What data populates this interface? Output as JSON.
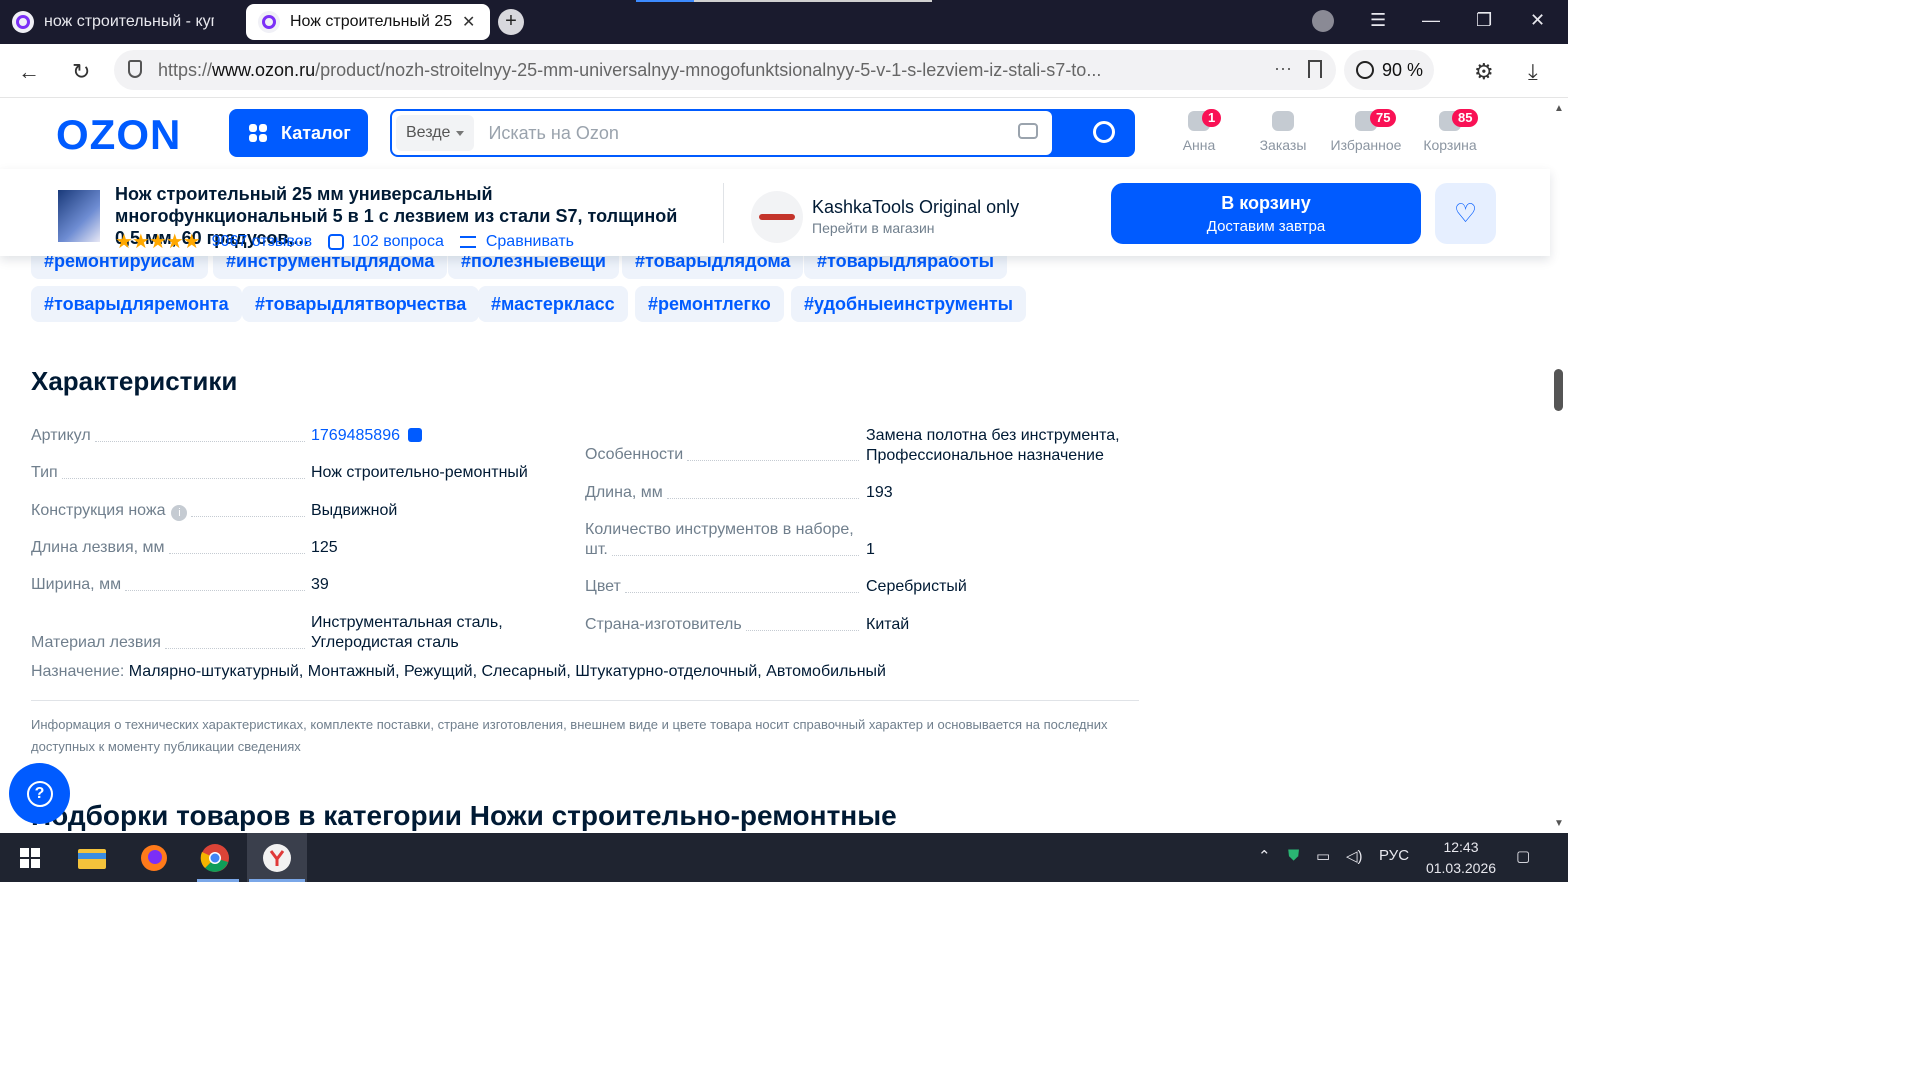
{
  "browser": {
    "tabs": [
      {
        "title": "нож строительный - купи"
      },
      {
        "title": "Нож строительный 25"
      }
    ],
    "tab_close": "✕",
    "new_tab": "+",
    "url_prefix": "https://",
    "url_domain": "www.ozon.ru",
    "url_path": "/product/nozh-stroitelnyy-25-mm-universalnyy-mnogofunktsionalnyy-5-v-1-s-lezviem-iz-stali-s7-to...",
    "url_more": "···",
    "zoom": "90 %"
  },
  "header": {
    "logo": "OZON",
    "catalog": "Каталог",
    "search_scope": "Везде",
    "search_placeholder": "Искать на Ozon",
    "icons": [
      {
        "label": "Анна",
        "badge": "1",
        "icon": "user-icon"
      },
      {
        "label": "Заказы",
        "badge": "",
        "icon": "box-icon"
      },
      {
        "label": "Избранное",
        "badge": "75",
        "icon": "heart-icon"
      },
      {
        "label": "Корзина",
        "badge": "85",
        "icon": "cart-icon"
      }
    ]
  },
  "product": {
    "title": "Нож строительный 25 мм универсальный многофункциональный 5 в 1 с лезвием из стали S7, толщиной 0,5 мм, 60 градусов,...",
    "stars": "★★★★★",
    "rating_value": 5,
    "reviews": "9067 отзывов",
    "questions": "102 вопроса",
    "compare": "Сравнивать",
    "seller_name": "KashkaTools Original only",
    "seller_link": "Перейти в магазин",
    "cart_button": "В корзину",
    "cart_sub": "Доставим завтра",
    "favorite_glyph": "♡"
  },
  "tags": [
    "#ремонтируйсам",
    "#инструментыдлядома",
    "#полезныевещи",
    "#товарыдлядома",
    "#товарыдляработы",
    "#товарыдляремонта",
    "#товарыдлятворчества",
    "#мастеркласс",
    "#ремонтлегко",
    "#удобныеинструменты"
  ],
  "specs": {
    "title": "Характеристики",
    "left": [
      {
        "label": "Артикул",
        "value": "1769485896"
      },
      {
        "label": "Тип",
        "value": "Нож строительно-ремонтный"
      },
      {
        "label": "Конструкция ножа",
        "value": "Выдвижной"
      },
      {
        "label": "Длина лезвия, мм",
        "value": "125"
      },
      {
        "label": "Ширина, мм",
        "value": "39"
      },
      {
        "label": "Материал лезвия",
        "value_1": "Инструментальная сталь,",
        "value_2": "Углеродистая сталь"
      }
    ],
    "right": [
      {
        "label": "Особенности",
        "value_1": "Замена полотна без инструмента,",
        "value_2": "Профессиональное назначение"
      },
      {
        "label": "Длина, мм",
        "value": "193"
      },
      {
        "label_1": "Количество инструментов в наборе,",
        "label_2": "шт.",
        "value": "1"
      },
      {
        "label": "Цвет",
        "value": "Серебристый"
      },
      {
        "label": "Страна-изготовитель",
        "value": "Китай"
      }
    ],
    "purpose_label": "Назначение:",
    "purpose_value": "Малярно-штукатурный, Монтажный, Режущий, Слесарный, Штукатурно-отделочный, Автомобильный",
    "info_i": "i",
    "note": "Информация о технических характеристиках, комплекте поставки, стране изготовления, внешнем виде и цвете товара носит справочный характер и основывается на последних доступных к моменту публикации сведениях"
  },
  "next_section": "Подборки товаров в категории Ножи строительно-ремонтные",
  "help_glyph": "?",
  "taskbar": {
    "lang": "РУС",
    "time": "12:43",
    "date": "01.03.2026"
  }
}
